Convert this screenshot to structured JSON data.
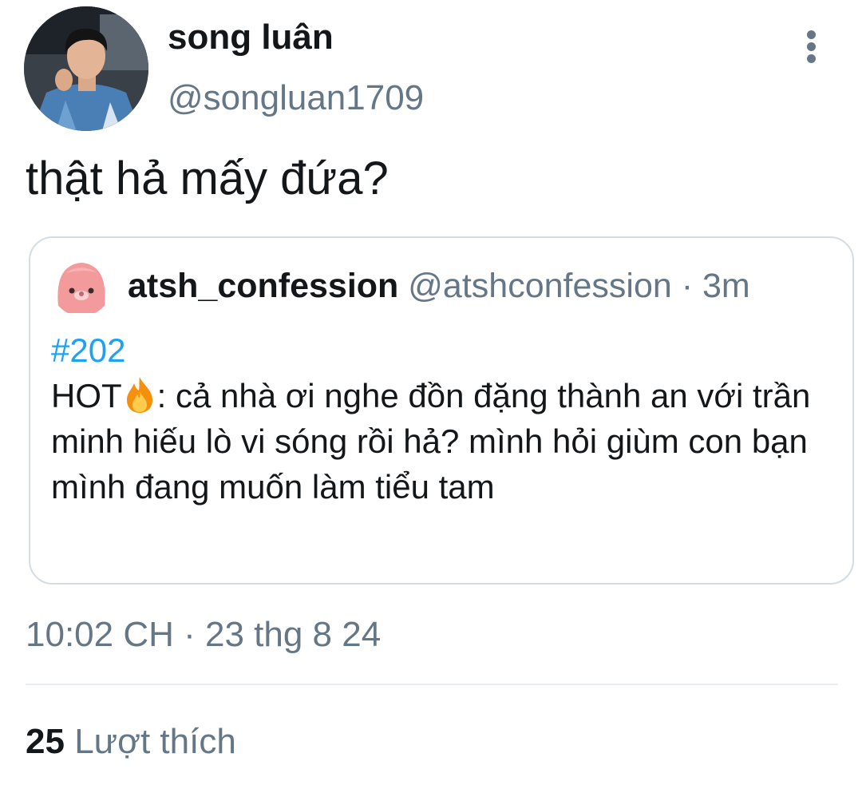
{
  "tweet": {
    "author": {
      "display_name": "song luân",
      "handle": "@songluan1709",
      "avatar_icon": "profile-photo"
    },
    "more_icon": "more-vertical-icon",
    "text": "thật hả mấy đứa?",
    "quoted": {
      "display_name": "atsh_confession",
      "handle": "@atshconfession",
      "separator": "·",
      "time": "3m",
      "avatar_icon": "pink-blob-avatar",
      "hashtag": "#202",
      "body_prefix": "HOT",
      "emoji_icon": "fire-icon",
      "body_text": ": cả nhà ơi nghe đồn đặng thành an với trần minh hiếu lò vi sóng rồi hả? mình hỏi giùm con bạn mình đang muốn làm tiểu tam"
    },
    "timestamp": "10:02 CH · 23 thg 8 24",
    "likes": {
      "count": "25",
      "label": "Lượt thích"
    }
  },
  "colors": {
    "text_primary": "#14171a",
    "text_secondary": "#657786",
    "hashtag": "#1da1f2",
    "card_border": "#d4dde4",
    "divider": "#e6ecf0"
  }
}
